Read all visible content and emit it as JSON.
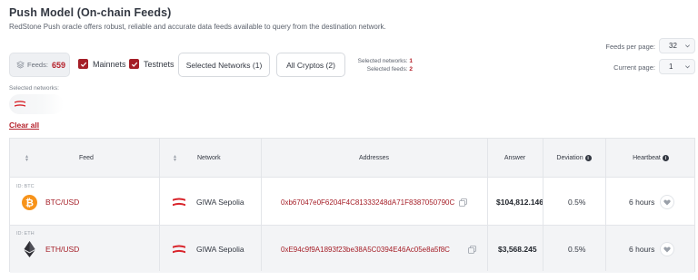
{
  "header": {
    "title": "Push Model (On-chain Feeds)",
    "subtitle": "RedStone Push oracle offers robust, reliable and accurate data feeds available to query from the destination network."
  },
  "filters": {
    "feeds_label": "Feeds:",
    "feeds_count": "659",
    "mainnets_label": "Mainnets",
    "mainnets_checked": true,
    "testnets_label": "Testnets",
    "testnets_checked": true,
    "selected_networks_button": "Selected Networks (1)",
    "all_cryptos_button": "All Cryptos (2)",
    "selected_networks_label": "Selected networks:",
    "selected_networks_value": "1",
    "selected_feeds_label": "Selected feeds:",
    "selected_feeds_value": "2",
    "selected_networks_section_label": "Selected networks:",
    "clear_all": "Clear all"
  },
  "pagination": {
    "feeds_per_page_label": "Feeds per page:",
    "feeds_per_page_value": "32",
    "current_page_label": "Current page:",
    "current_page_value": "1"
  },
  "table": {
    "headers": {
      "feed": "Feed",
      "network": "Network",
      "addresses": "Addresses",
      "answer": "Answer",
      "deviation": "Deviation",
      "heartbeat": "Heartbeat"
    },
    "rows": [
      {
        "id_label": "ID: BTC",
        "pair": "BTC/USD",
        "network": "GIWA Sepolia",
        "address": "0xb67047e0F6204F4C81333248dA71F8387050790C",
        "answer": "$104,812.146",
        "deviation": "0.5%",
        "heartbeat": "6 hours"
      },
      {
        "id_label": "ID: ETH",
        "pair": "ETH/USD",
        "network": "GIWA Sepolia",
        "address": "0xE94c9f9A1893f23be38A5C0394E46Ac05e8a5f8C",
        "answer": "$3,568.245",
        "deviation": "0.5%",
        "heartbeat": "6 hours"
      }
    ]
  },
  "colors": {
    "accent": "#a51e27",
    "bitcoin": "#f7931a",
    "header_bg": "#f3f4f6"
  },
  "icons": [
    "layers-icon",
    "checkbox-checked-icon",
    "chevron-down-icon",
    "giwa-network-icon",
    "bitcoin-icon",
    "ethereum-icon",
    "copy-icon",
    "heart-icon",
    "info-icon",
    "sort-icon"
  ]
}
